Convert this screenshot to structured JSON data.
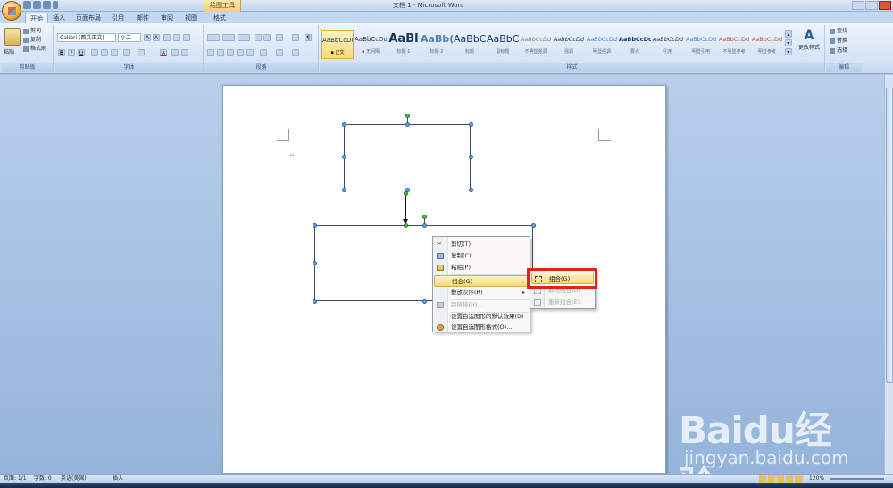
{
  "window": {
    "title": "文档 1 - Microsoft Word",
    "contextual_tab_group": "绘图工具"
  },
  "ribbon_tabs": [
    "开始",
    "插入",
    "页面布局",
    "引用",
    "邮件",
    "审阅",
    "视图",
    "格式"
  ],
  "active_tab": "开始",
  "clipboard": {
    "paste_label": "粘贴",
    "cut_label": "剪切",
    "copy_label": "复制",
    "format_painter_label": "格式刷",
    "group_label": "剪贴板"
  },
  "font": {
    "font_name": "Calibri (西文正文)",
    "font_size": "小二",
    "group_label": "字体"
  },
  "paragraph": {
    "group_label": "段落"
  },
  "styles": {
    "group_label": "样式",
    "items": [
      {
        "sample": "AaBbCcDd",
        "name": "▪ 正文"
      },
      {
        "sample": "AaBbCcDd",
        "name": "▪ 无间隔"
      },
      {
        "sample": "AaBl",
        "name": "标题 1"
      },
      {
        "sample": "AaBb(",
        "name": "标题 2"
      },
      {
        "sample": "AaBbC",
        "name": "标题"
      },
      {
        "sample": "AaBbC",
        "name": "副标题"
      },
      {
        "sample": "AaBbCcDd",
        "name": "不明显强调"
      },
      {
        "sample": "AaBbCcDd",
        "name": "强调"
      },
      {
        "sample": "AaBbCcDd",
        "name": "明显强调"
      },
      {
        "sample": "AaBbCcDc",
        "name": "要点"
      },
      {
        "sample": "AaBbCcDd",
        "name": "引用"
      },
      {
        "sample": "AaBbCcDd",
        "name": "明显引用"
      },
      {
        "sample": "AaBbCcDd",
        "name": "不明显参考"
      },
      {
        "sample": "AaBbCcDd",
        "name": "明显参考"
      }
    ],
    "change_styles_label": "更改样式"
  },
  "editing": {
    "find_label": "查找",
    "replace_label": "替换",
    "select_label": "选择",
    "group_label": "编辑"
  },
  "context_menu": {
    "items": [
      {
        "label": "剪切(T)",
        "disabled": false,
        "icon": "scissors-icon"
      },
      {
        "label": "复制(C)",
        "disabled": false,
        "icon": "copy-icon"
      },
      {
        "label": "粘贴(P)",
        "disabled": false,
        "icon": "paste-icon"
      },
      {
        "label": "组合(G)",
        "disabled": false,
        "icon": "",
        "submenu": true,
        "highlighted": true
      },
      {
        "label": "叠放次序(R)",
        "disabled": false,
        "icon": "",
        "submenu": true
      },
      {
        "label": "超链接(H)...",
        "disabled": true,
        "icon": "hyperlink-icon"
      },
      {
        "label": "设置自选图形的默认效果(D)",
        "disabled": false,
        "icon": ""
      },
      {
        "label": "设置自选图形格式(O)...",
        "disabled": false,
        "icon": "format-shape-icon"
      }
    ]
  },
  "submenu": {
    "items": [
      {
        "label": "组合(G)",
        "disabled": false,
        "highlighted": true,
        "icon": "group-icon"
      },
      {
        "label": "取消组合(U)",
        "disabled": true,
        "icon": "ungroup-icon"
      },
      {
        "label": "重新组合(E)",
        "disabled": true,
        "icon": "regroup-icon"
      }
    ]
  },
  "status": {
    "page": "页面: 1/1",
    "words": "字数: 0",
    "language": "英语(美国)",
    "insert_mode": "插入",
    "zoom": "120%"
  },
  "watermark": {
    "brand": "Baidu经验",
    "url": "jingyan.baidu.com"
  },
  "colors": {
    "accent": "#e8201a",
    "menu_highlight": "#fbd878",
    "workspace": "#a9c3e4"
  }
}
